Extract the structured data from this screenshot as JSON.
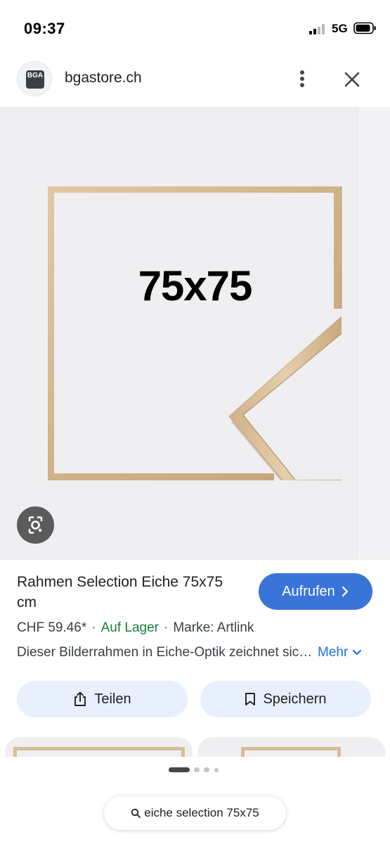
{
  "status_bar": {
    "time": "09:37",
    "network": "5G",
    "icons": [
      "signal-icon",
      "battery-icon"
    ]
  },
  "header": {
    "site_name": "bgastore.ch",
    "logo_text": "BGA",
    "icons": [
      "site-logo",
      "more-vert-icon",
      "close-icon"
    ]
  },
  "image": {
    "size_label": "75x75",
    "frame_color": "#d2b48c",
    "icons": [
      "google-lens-icon"
    ]
  },
  "product": {
    "title": "Rahmen Selection Eiche 75x75 cm",
    "visit_button": "Aufrufen",
    "price": "CHF 59.46*",
    "separator": "·",
    "stock": "Auf Lager",
    "brand": "Marke: Artlink",
    "description": "Dieser Bilderrahmen in Eiche-Optik zeichnet sich durch",
    "more_link": "Mehr"
  },
  "actions": {
    "share": "Teilen",
    "save": "Speichern"
  },
  "search": {
    "query": "eiche selection 75x75"
  },
  "colors": {
    "accent": "#3a74d9",
    "stock_green": "#188038",
    "link_blue": "#1a73e8",
    "chip_bg": "#e8f0fe"
  }
}
